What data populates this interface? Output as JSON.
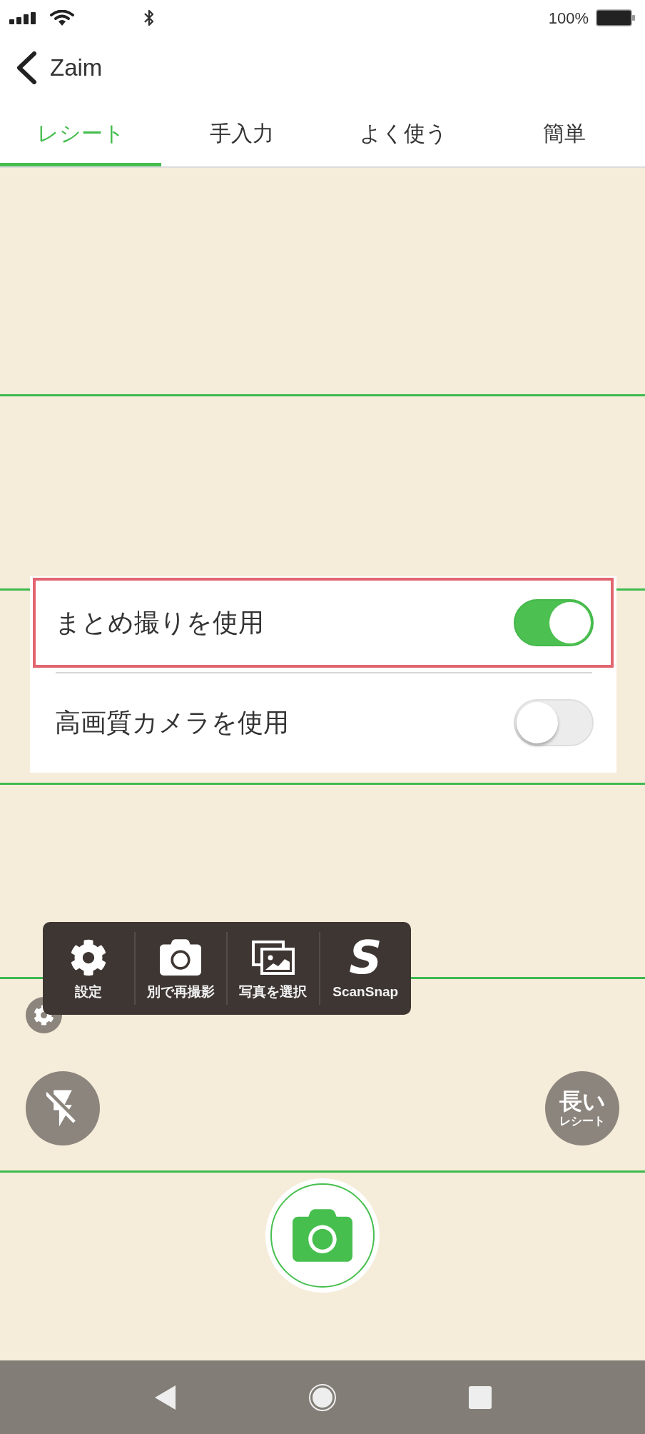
{
  "status_bar": {
    "battery_text": "100%"
  },
  "header": {
    "title": "Zaim"
  },
  "tabs": [
    {
      "label": "レシート",
      "selected": true
    },
    {
      "label": "手入力",
      "selected": false
    },
    {
      "label": "よく使う",
      "selected": false
    },
    {
      "label": "簡単",
      "selected": false
    }
  ],
  "settings": [
    {
      "label": "まとめ撮りを使用",
      "on": true,
      "highlighted": true
    },
    {
      "label": "高画質カメラを使用",
      "on": false,
      "highlighted": false
    }
  ],
  "toolbar": [
    {
      "kind": "settings",
      "label": "設定"
    },
    {
      "kind": "camera",
      "label": "別で再撮影"
    },
    {
      "kind": "photos",
      "label": "写真を選択"
    },
    {
      "kind": "scansnap",
      "glyph": "S",
      "label": "ScanSnap"
    }
  ],
  "long_receipt_button": {
    "title": "長い",
    "subtitle": "レシート"
  }
}
